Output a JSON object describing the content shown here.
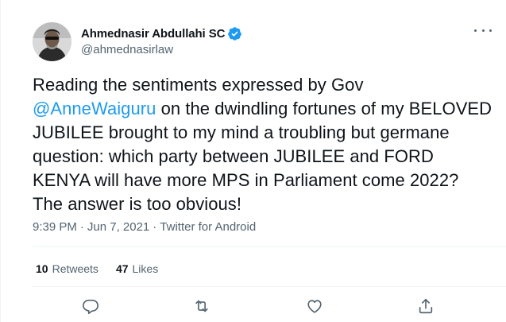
{
  "tweet": {
    "author": {
      "display_name": "Ahmednasir Abdullahi SC",
      "handle": "@ahmednasirlaw",
      "verified": true,
      "avatar_icon": "profile-photo"
    },
    "text_before": "Reading the sentiments expressed by Gov\n",
    "mention": "@AnneWaiguru",
    "text_after": " on the dwindling fortunes of my BELOVED JUBILEE brought to my mind a troubling but germane question: which party between JUBILEE and FORD KENYA will have more MPS in Parliament come 2022? The answer is too obvious!",
    "time": "9:39 PM",
    "separator": "·",
    "date": "Jun 7, 2021",
    "source": "Twitter for Android",
    "stats": {
      "retweets_count": "10",
      "retweets_label": "Retweets",
      "likes_count": "47",
      "likes_label": "Likes"
    },
    "actions": [
      "reply-icon",
      "retweet-icon",
      "like-icon",
      "share-icon"
    ]
  },
  "colors": {
    "text": "#0f1419",
    "secondary": "#536471",
    "link": "#1d9bf0",
    "verified": "#1d9bf0",
    "divider": "#eff3f4"
  }
}
